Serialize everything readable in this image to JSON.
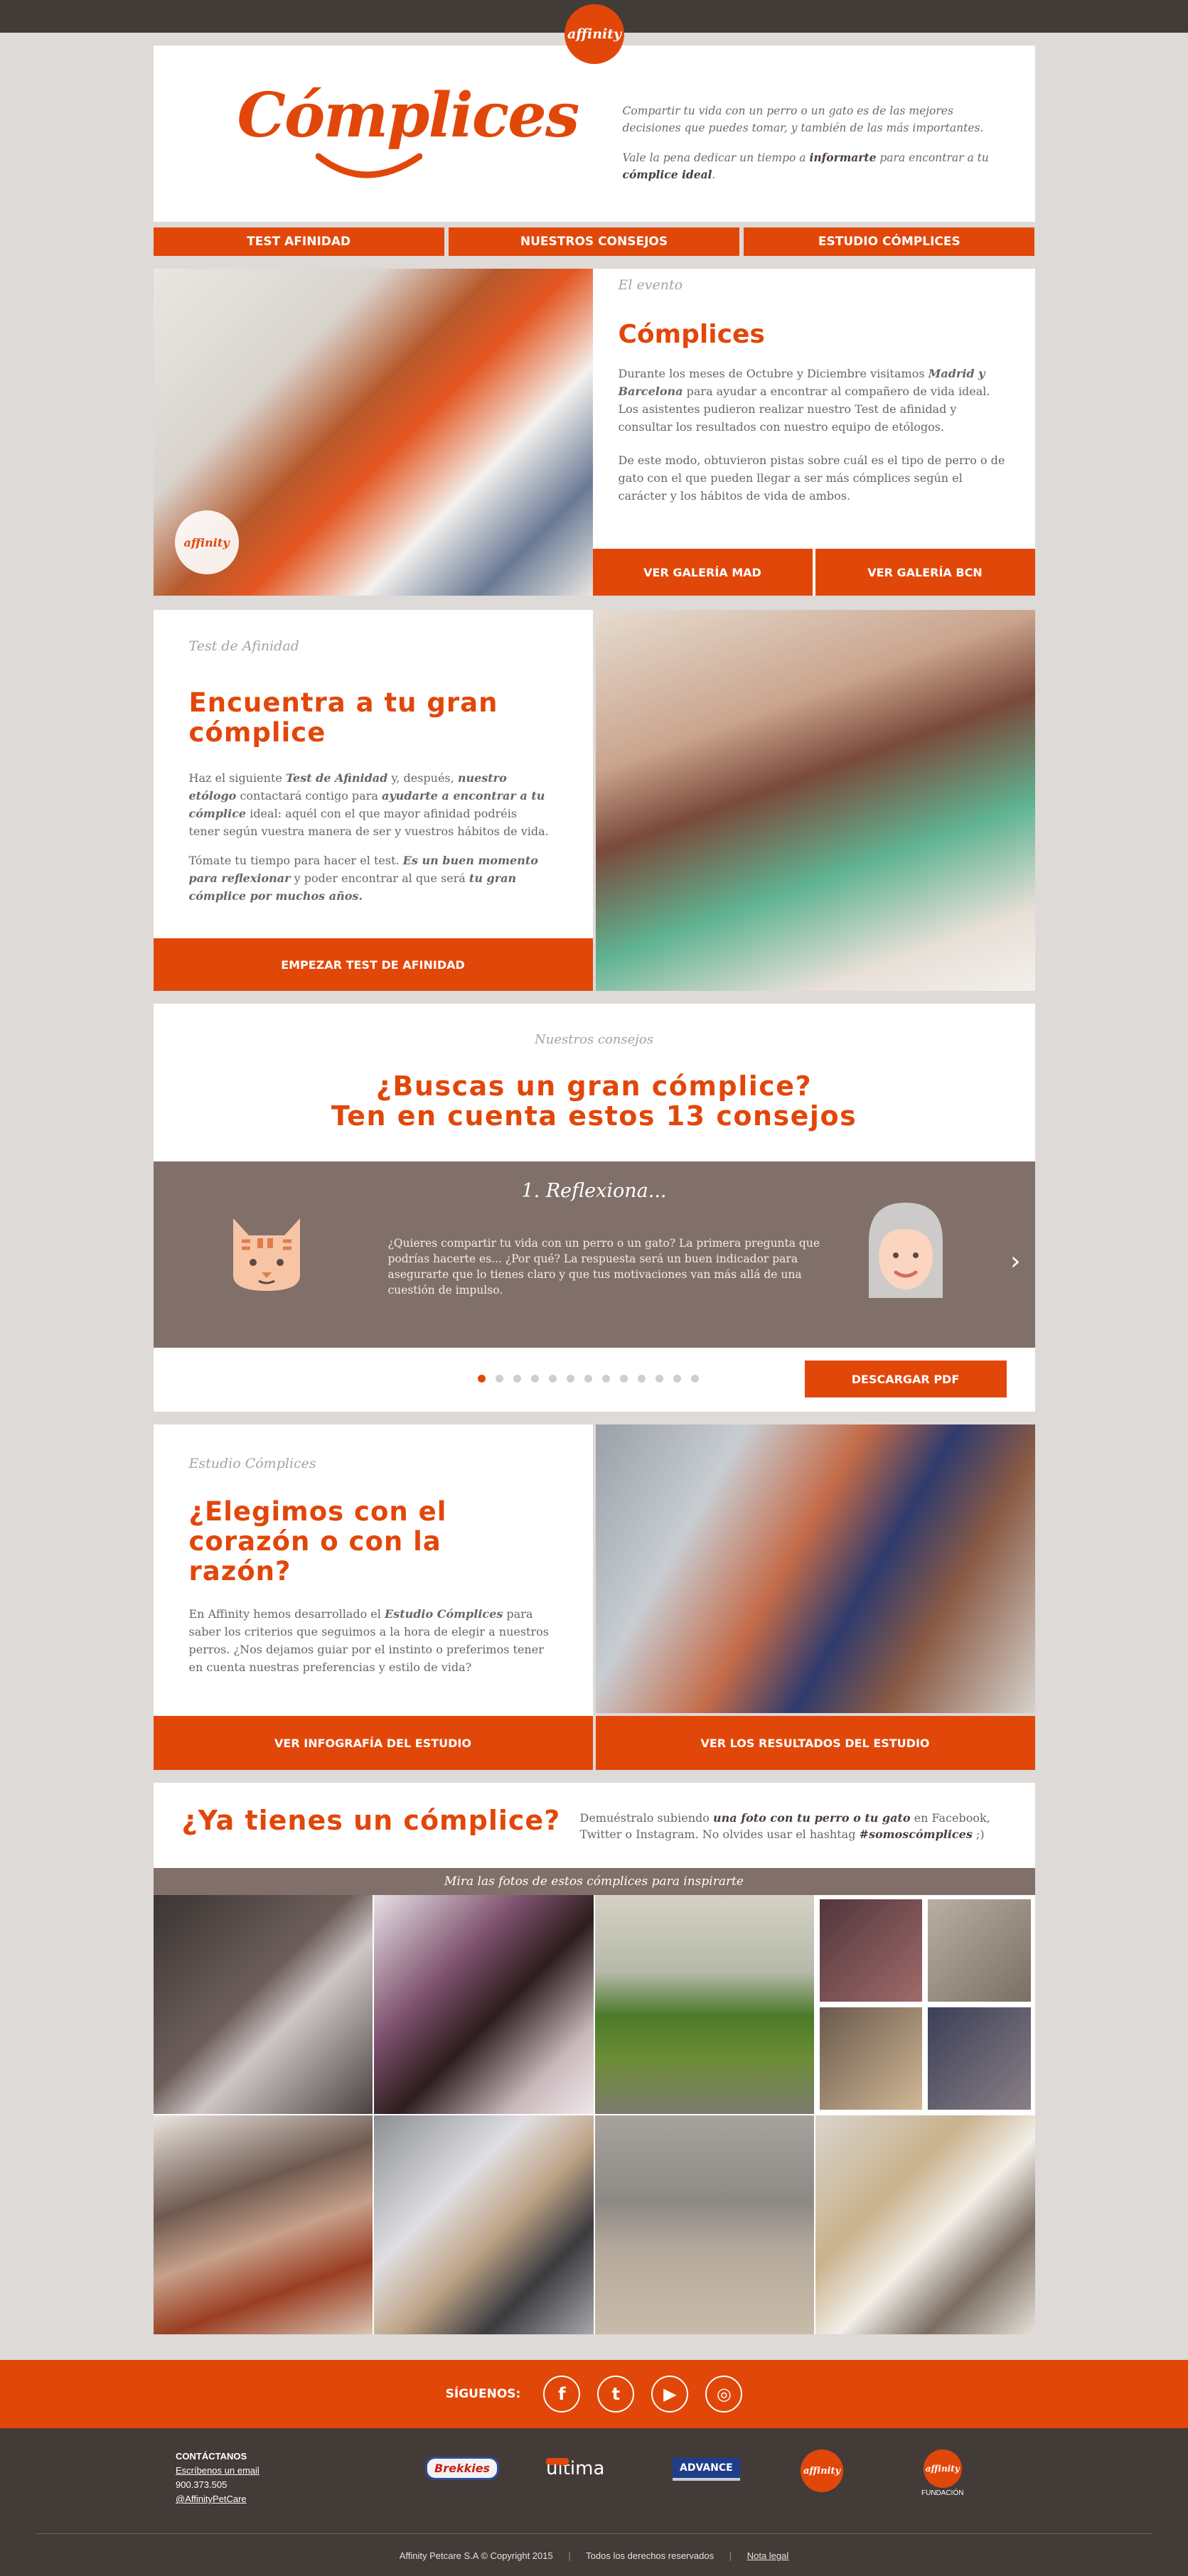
{
  "brand": {
    "badge": "affinity",
    "logo": "Cómplices"
  },
  "header": {
    "intro": "Compartir tu vida con un perro o un gato es de las mejores decisiones que puedes tomar, y también de las más importantes.",
    "line2_pre": "Vale la pena dedicar un tiempo a ",
    "line2_bold": "informarte",
    "line2_mid": " para encontrar a tu ",
    "line2_bold2": "cómplice ideal",
    "line2_end": "."
  },
  "nav": [
    "TEST AFINIDAD",
    "NUESTROS CONSEJOS",
    "ESTUDIO CÓMPLICES"
  ],
  "event": {
    "kicker": "El evento",
    "title": "Cómplices",
    "p1_a": "Durante los meses de Octubre y Diciembre visitamos ",
    "p1_b": "Madrid y Barcelona",
    "p1_c": " para ayudar a encontrar al compañero de vida ideal. Los asistentes pudieron realizar nuestro Test de afinidad y consultar los resultados con nuestro equipo de etólogos.",
    "p2": "De este modo, obtuvieron pistas sobre cuál es el tipo de perro o de gato con el que pueden llegar a ser más cómplices según el carácter y los hábitos de vida de ambos.",
    "btn_mad": "VER GALERÍA MAD",
    "btn_bcn": "VER GALERÍA BCN",
    "photo_badge": "affinity"
  },
  "test": {
    "kicker": "Test de Afinidad",
    "title_l1": "Encuentra a tu gran",
    "title_l2": "cómplice",
    "p1_a": "Haz el siguiente ",
    "p1_b": "Test de Afinidad",
    "p1_c": " y, después, ",
    "p1_d": "nuestro etólogo",
    "p1_e": " contactará contigo para ",
    "p1_f": "ayudarte a encontrar a tu cómplice",
    "p1_g": " ideal: aquél con el que mayor afinidad podréis tener según vuestra manera de ser y vuestros hábitos de vida.",
    "p2_a": "Tómate tu tiempo para hacer el test. ",
    "p2_b": "Es un buen momento para reflexionar",
    "p2_c": " y poder encontrar al que será ",
    "p2_d": "tu gran cómplice por muchos años.",
    "btn": "EMPEZAR TEST DE AFINIDAD"
  },
  "tips": {
    "kicker": "Nuestros consejos",
    "title_l1": "¿Buscas un gran cómplice?",
    "title_l2": "Ten en cuenta estos 13 consejos",
    "tip_title": "1. Reflexiona...",
    "tip_text": "¿Quieres compartir tu vida con un perro o un gato? La primera pregunta que podrías hacerte es... ¿Por qué? La respuesta será un buen indicador para asegurarte que lo tienes claro y que tus motivaciones van más allá de una cuestión de impulso.",
    "next": "›",
    "dot_count": 13,
    "active_dot": 1,
    "pdf_btn": "DESCARGAR PDF"
  },
  "study": {
    "kicker": "Estudio Cómplices",
    "title_l1": "¿Elegimos con el",
    "title_l2": "corazón o con la razón?",
    "p_a": "En Affinity hemos desarrollado el ",
    "p_b": "Estudio Cómplices",
    "p_c": " para saber los criterios que seguimos a la hora de elegir a nuestros perros. ¿Nos dejamos guiar por el instinto o preferimos tener en cuenta nuestras preferencias y estilo de vida?",
    "btn_info": "VER INFOGRAFÍA DEL ESTUDIO",
    "btn_results": "VER LOS RESULTADOS DEL ESTUDIO"
  },
  "ugc": {
    "title": "¿Ya tienes un cómplice?",
    "text_a": "Demuéstralo subiendo ",
    "text_b": "una foto con tu perro o tu gato",
    "text_c": " en Facebook, Twitter o Instagram. No olvides usar el hashtag ",
    "text_d": "#somoscómplices",
    "text_e": " ;)",
    "bar": "Mira las fotos de estos cómplices para inspirarte"
  },
  "social": {
    "label": "SÍGUENOS:",
    "icons": [
      "f",
      "t",
      "▶",
      "◎"
    ]
  },
  "footer": {
    "contact_title": "CONTÁCTANOS",
    "email_link": "Escríbenos un email",
    "phone": "900.373.505",
    "twitter": "@AffinityPetCare",
    "brands": {
      "brekkies": "Brekkies",
      "ultima": "ultima",
      "advance": "ADVANCE",
      "affinity": "affinity",
      "fundacion_logo": "affinity",
      "fundacion": "FUNDACIÓN"
    },
    "copyright": "Affinity Petcare S.A © Copyright 2015",
    "rights": "Todos los derechos reservados",
    "legal": "Nota legal",
    "sep": "|"
  }
}
